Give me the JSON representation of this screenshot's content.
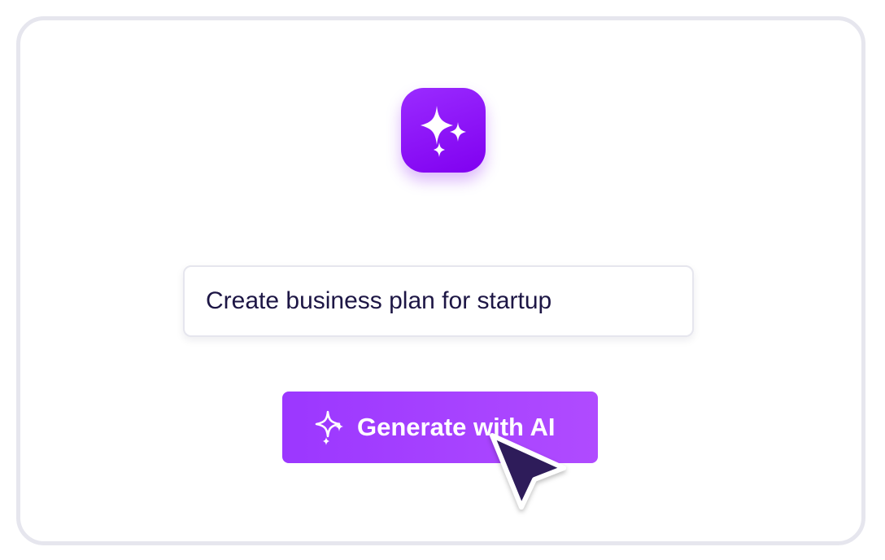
{
  "app": {
    "icon": "sparkles-icon",
    "accent_color": "#8000F0"
  },
  "prompt": {
    "value": "Create business plan for startup"
  },
  "generate_button": {
    "label": "Generate with AI",
    "icon": "sparkles-icon",
    "color": "#A041FF"
  },
  "cursor": {
    "icon": "mouse-pointer-icon"
  }
}
